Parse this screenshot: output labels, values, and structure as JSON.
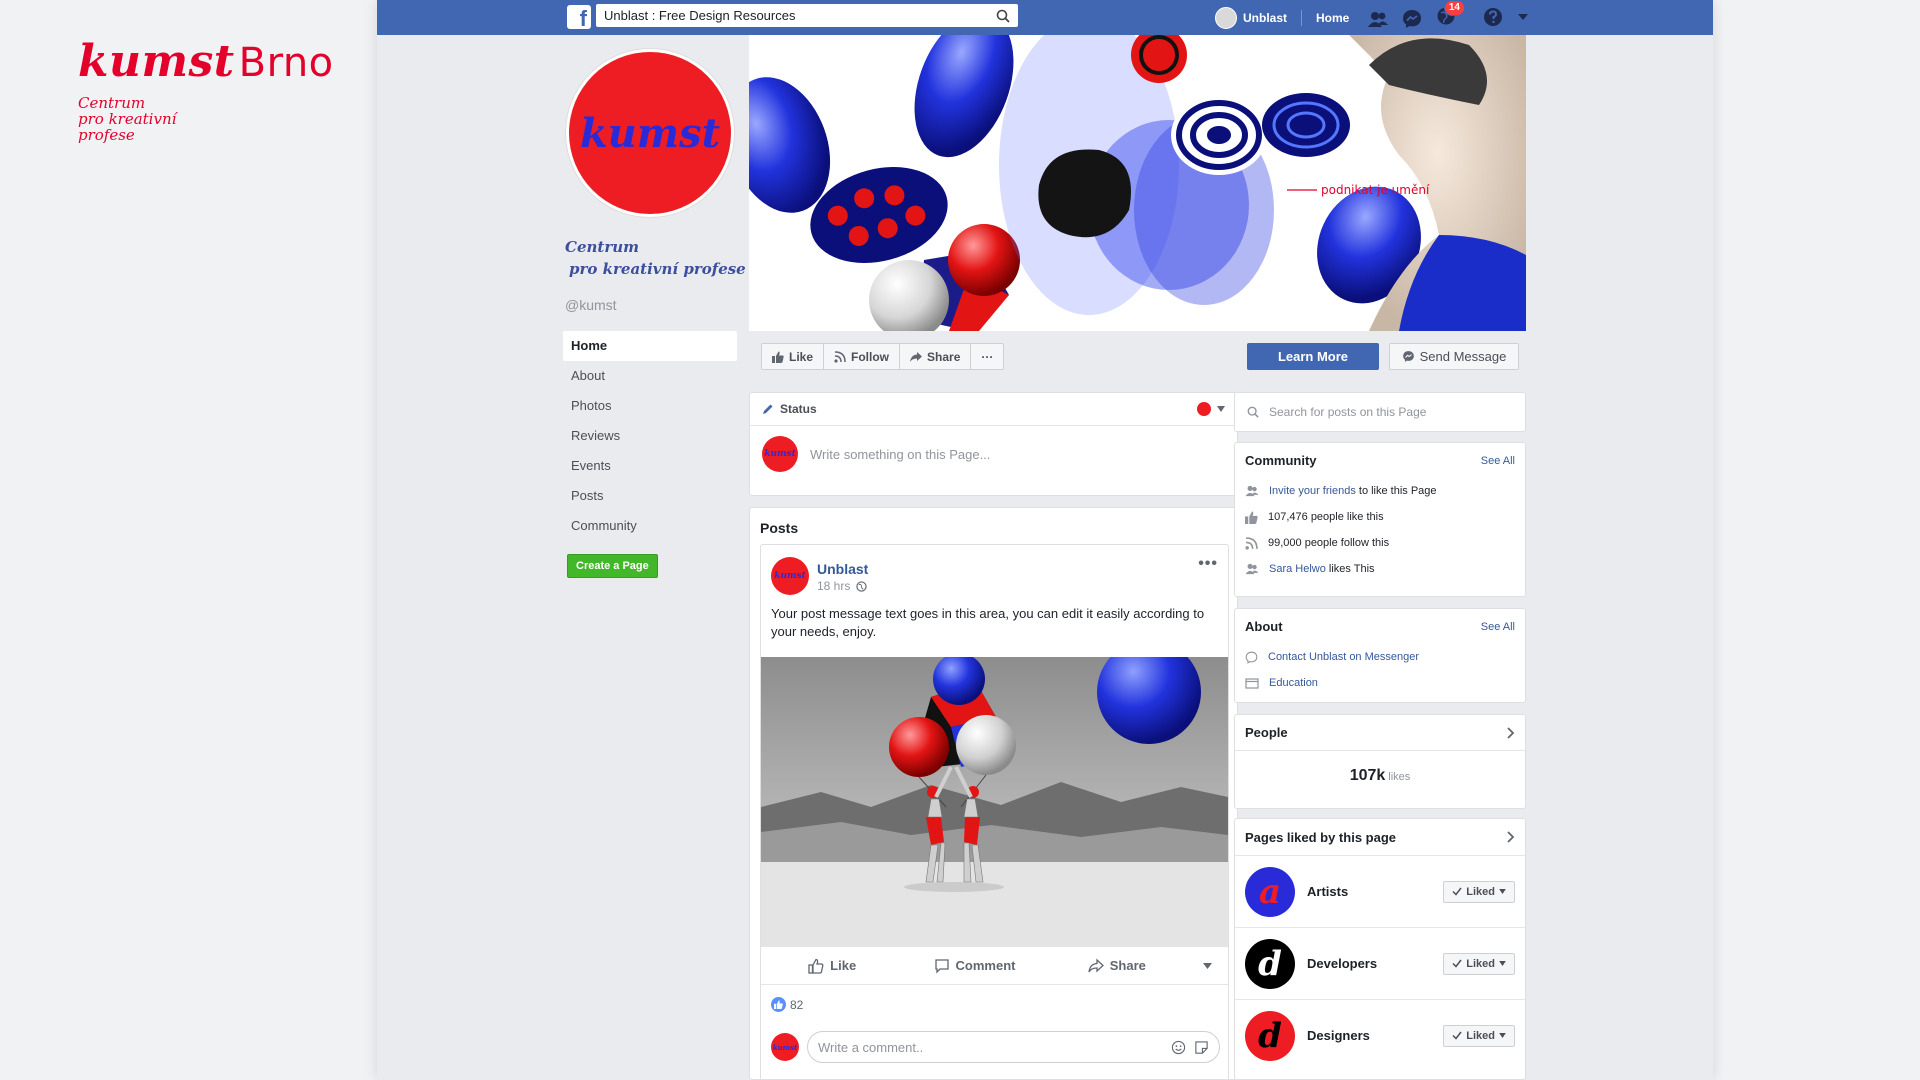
{
  "brand": {
    "title": "kumst",
    "city": "Brno",
    "subtitle_lines": [
      "Centrum",
      "pro kreativní",
      "profese"
    ]
  },
  "topbar": {
    "search_value": "Unblast : Free Design Resources",
    "user_name": "Unblast",
    "home_label": "Home",
    "notification_count": "14"
  },
  "profile": {
    "logo_text": "kumst",
    "name_line1": "Centrum",
    "name_line2": "pro kreativní profese",
    "handle": "@kumst"
  },
  "nav": {
    "items": [
      "Home",
      "About",
      "Photos",
      "Reviews",
      "Events",
      "Posts",
      "Community"
    ],
    "create_page": "Create a Page"
  },
  "cover": {
    "tagline": "podnikat je umění"
  },
  "actions": {
    "like": "Like",
    "follow": "Follow",
    "share": "Share",
    "more": "···",
    "learn_more": "Learn More",
    "send_message": "Send Message"
  },
  "status": {
    "label": "Status",
    "placeholder": "Write something on this Page..."
  },
  "posts": {
    "title": "Posts",
    "author": "Unblast",
    "time": "18 hrs",
    "text": "Your post message text goes in this area, you can edit it easily according to your needs, enjoy.",
    "like": "Like",
    "comment": "Comment",
    "share": "Share",
    "like_count": "82",
    "comment_placeholder": "Write a comment.."
  },
  "search_page": {
    "placeholder": "Search for posts on this Page"
  },
  "community": {
    "title": "Community",
    "see_all": "See All",
    "invite_link": "Invite your friends",
    "invite_rest": " to like this Page",
    "likes": "107,476 people like this",
    "follows": "99,000 people follow this",
    "friend_link": "Sara Helwo",
    "friend_rest": " likes This"
  },
  "about": {
    "title": "About",
    "see_all": "See All",
    "messenger": "Contact Unblast on Messenger",
    "education": "Education"
  },
  "people": {
    "title": "People",
    "count": "107k",
    "likes_label": "likes"
  },
  "pages_liked": {
    "title": "Pages liked by this page",
    "items": [
      {
        "name": "Artists",
        "letter": "a",
        "bg": "#2a2bd8",
        "fg": "#ee1d23"
      },
      {
        "name": "Developers",
        "letter": "d",
        "bg": "#000000",
        "fg": "#ffffff"
      },
      {
        "name": "Designers",
        "letter": "d",
        "bg": "#ee1d23",
        "fg": "#000000"
      }
    ],
    "liked_label": "Liked"
  },
  "colors": {
    "fb_blue": "#4267b2",
    "brand_red": "#e4002b",
    "brand_blue": "#2a2bd8"
  }
}
